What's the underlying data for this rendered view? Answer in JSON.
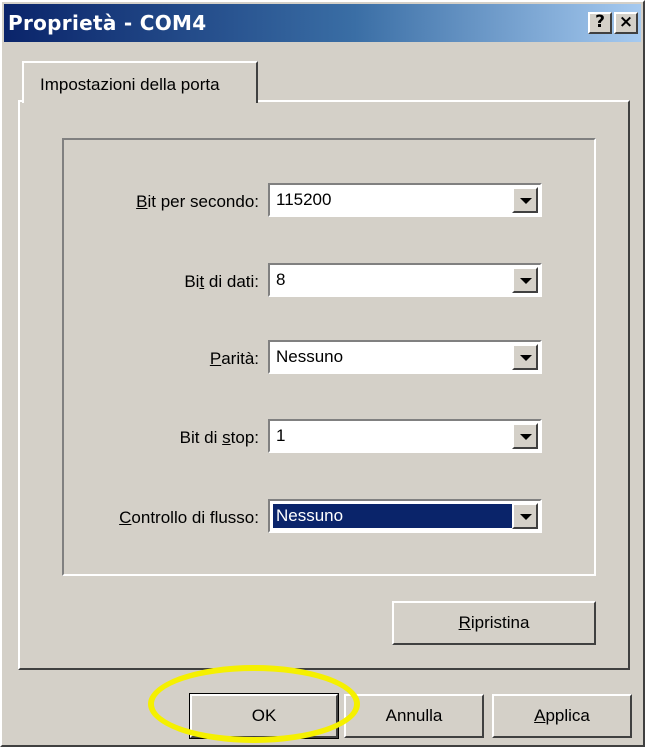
{
  "window": {
    "title": "Proprietà - COM4",
    "help_label": "?",
    "close_label": "×"
  },
  "tabs": [
    {
      "label": "Impostazioni della porta",
      "active": true
    }
  ],
  "fields": [
    {
      "label_pre": "",
      "label_ul": "B",
      "label_post": "it per secondo:",
      "value": "115200",
      "selected": false
    },
    {
      "label_pre": "Bi",
      "label_ul": "t",
      "label_post": " di dati:",
      "value": "8",
      "selected": false
    },
    {
      "label_pre": "",
      "label_ul": "P",
      "label_post": "arità:",
      "value": "Nessuno",
      "selected": false
    },
    {
      "label_pre": "Bit di ",
      "label_ul": "s",
      "label_post": "top:",
      "value": "1",
      "selected": false
    },
    {
      "label_pre": "",
      "label_ul": "C",
      "label_post": "ontrollo di flusso:",
      "value": "Nessuno",
      "selected": true
    }
  ],
  "buttons": {
    "restore": {
      "ul": "R",
      "rest": "ipristina"
    },
    "ok": {
      "label": "OK"
    },
    "cancel": {
      "label": "Annulla"
    },
    "apply": {
      "ul": "A",
      "rest": "pplica"
    }
  },
  "colors": {
    "highlight_ellipse": "#f5f000",
    "selection": "#0a246a"
  }
}
